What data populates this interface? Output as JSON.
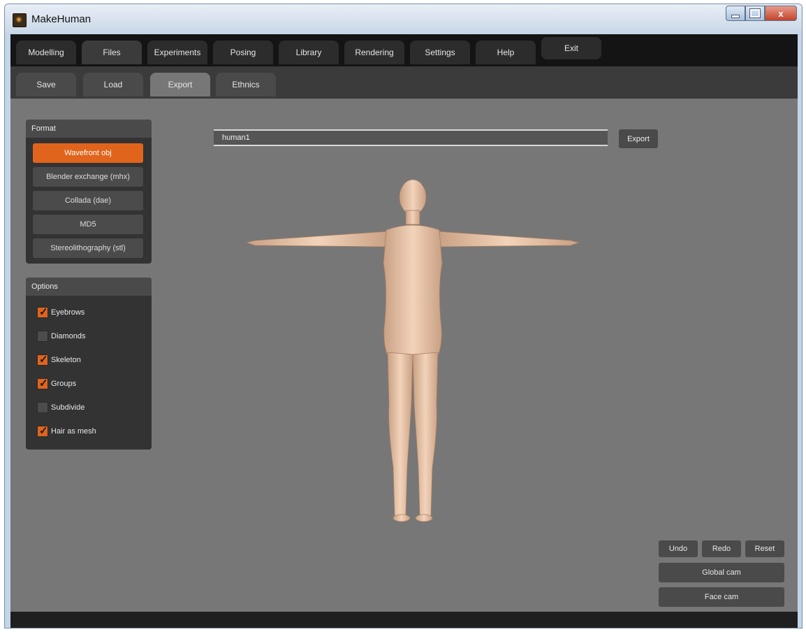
{
  "window": {
    "title": "MakeHuman",
    "min_label": "",
    "max_label": "",
    "close_label": "x"
  },
  "main_tabs": [
    "Modelling",
    "Files",
    "Experiments",
    "Posing",
    "Library",
    "Rendering",
    "Settings",
    "Help",
    "Exit"
  ],
  "active_main_tab": "Files",
  "sub_tabs": [
    "Save",
    "Load",
    "Export",
    "Ethnics"
  ],
  "active_sub_tab": "Export",
  "format_panel": {
    "title": "Format",
    "options": [
      "Wavefront obj",
      "Blender exchange (mhx)",
      "Collada (dae)",
      "MD5",
      "Stereolithography (stl)"
    ],
    "selected": "Wavefront obj"
  },
  "options_panel": {
    "title": "Options",
    "items": [
      {
        "label": "Eyebrows",
        "checked": true
      },
      {
        "label": "Diamonds",
        "checked": false
      },
      {
        "label": "Skeleton",
        "checked": true
      },
      {
        "label": "Groups",
        "checked": true
      },
      {
        "label": "Subdivide",
        "checked": false
      },
      {
        "label": "Hair as mesh",
        "checked": true
      }
    ]
  },
  "export": {
    "filename": "human1",
    "button_label": "Export"
  },
  "controls": {
    "undo": "Undo",
    "redo": "Redo",
    "reset": "Reset",
    "global_cam": "Global cam",
    "face_cam": "Face cam"
  },
  "colors": {
    "accent": "#e0641c",
    "viewport": "#777777",
    "panel": "#333333"
  }
}
